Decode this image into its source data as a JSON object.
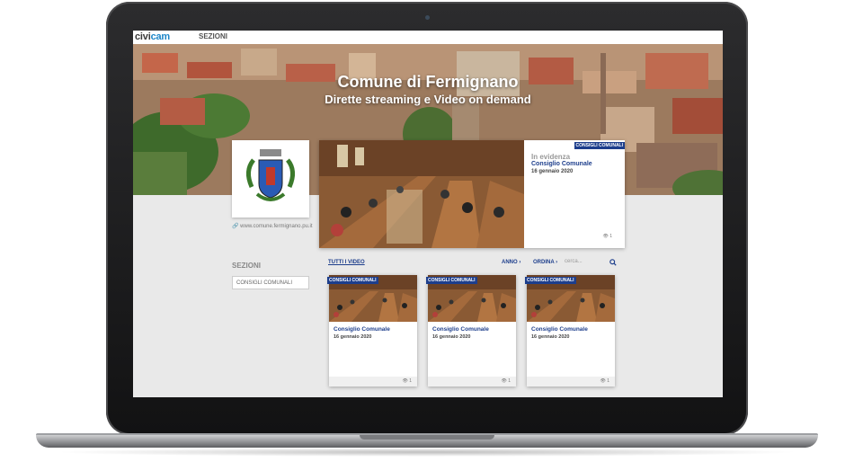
{
  "navbar": {
    "logo_text": "civi",
    "logo_accent": "cam",
    "link": "SEZIONI"
  },
  "hero": {
    "title": "Comune di Fermignano",
    "subtitle": "Dirette streaming e Video on demand"
  },
  "sidebar": {
    "website": "www.comune.fermignano.pu.it",
    "heading": "SEZIONI",
    "item": "CONSIGLI COMUNALI"
  },
  "featured": {
    "tag": "CONSIGLI COMUNALI",
    "label": "In evidenza",
    "title": "Consiglio Comunale",
    "date": "16 gennaio 2020",
    "views": "1"
  },
  "toolbar": {
    "all_videos": "TUTTI I VIDEO",
    "year": "ANNO",
    "sort": "ORDINA",
    "search_placeholder": "cerca..."
  },
  "videos": [
    {
      "tag": "CONSIGLI COMUNALI",
      "title": "Consiglio Comunale",
      "date": "16 gennaio 2020",
      "views": "1"
    },
    {
      "tag": "CONSIGLI COMUNALI",
      "title": "Consiglio Comunale",
      "date": "16 gennaio 2020",
      "views": "1"
    },
    {
      "tag": "CONSIGLI COMUNALI",
      "title": "Consiglio Comunale",
      "date": "16 gennaio 2020",
      "views": "1"
    }
  ],
  "colors": {
    "accent": "#1d3e8c",
    "logo_accent": "#1d86c8"
  }
}
